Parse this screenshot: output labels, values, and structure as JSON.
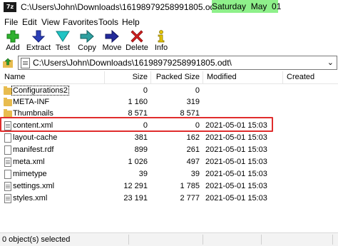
{
  "titlebar": {
    "app_icon": "7z",
    "path": "C:\\Users\\John\\Downloads\\16198979258991805.odt\\",
    "date_overlay": "Saturday  May  01"
  },
  "menu": [
    "File",
    "Edit",
    "View",
    "Favorites",
    "Tools",
    "Help"
  ],
  "toolbar": [
    {
      "label": "Add",
      "icon": "add-icon",
      "color": "#2fb12f"
    },
    {
      "label": "Extract",
      "icon": "extract-icon",
      "color": "#2b3fb8"
    },
    {
      "label": "Test",
      "icon": "test-icon",
      "color": "#1fc4c4"
    },
    {
      "label": "Copy",
      "icon": "copy-icon",
      "color": "#2fa0a0"
    },
    {
      "label": "Move",
      "icon": "move-icon",
      "color": "#232b9c"
    },
    {
      "label": "Delete",
      "icon": "delete-icon",
      "color": "#d01f1f"
    },
    {
      "label": "Info",
      "icon": "info-icon",
      "color": "#e3c400"
    }
  ],
  "address": {
    "value": "C:\\Users\\John\\Downloads\\16198979258991805.odt\\"
  },
  "columns": {
    "name": "Name",
    "size": "Size",
    "packed": "Packed Size",
    "modified": "Modified",
    "created": "Created"
  },
  "files": [
    {
      "name": "Configurations2",
      "type": "folder",
      "size": "0",
      "packed": "0",
      "modified": ""
    },
    {
      "name": "META-INF",
      "type": "folder",
      "size": "1 160",
      "packed": "319",
      "modified": ""
    },
    {
      "name": "Thumbnails",
      "type": "folder",
      "size": "8 571",
      "packed": "8 571",
      "modified": ""
    },
    {
      "name": "content.xml",
      "type": "xml",
      "size": "0",
      "packed": "0",
      "modified": "2021-05-01 15:03"
    },
    {
      "name": "layout-cache",
      "type": "file",
      "size": "381",
      "packed": "162",
      "modified": "2021-05-01 15:03"
    },
    {
      "name": "manifest.rdf",
      "type": "file",
      "size": "899",
      "packed": "261",
      "modified": "2021-05-01 15:03"
    },
    {
      "name": "meta.xml",
      "type": "xml",
      "size": "1 026",
      "packed": "497",
      "modified": "2021-05-01 15:03"
    },
    {
      "name": "mimetype",
      "type": "file",
      "size": "39",
      "packed": "39",
      "modified": "2021-05-01 15:03"
    },
    {
      "name": "settings.xml",
      "type": "xml",
      "size": "12 291",
      "packed": "1 785",
      "modified": "2021-05-01 15:03"
    },
    {
      "name": "styles.xml",
      "type": "xml",
      "size": "23 191",
      "packed": "2 777",
      "modified": "2021-05-01 15:03"
    }
  ],
  "status": {
    "selection": "0 object(s) selected"
  },
  "colors": {
    "highlight_box": "#e02d2d",
    "date_overlay_bg": "#8ef08a",
    "folder": "#e8bc4f"
  }
}
